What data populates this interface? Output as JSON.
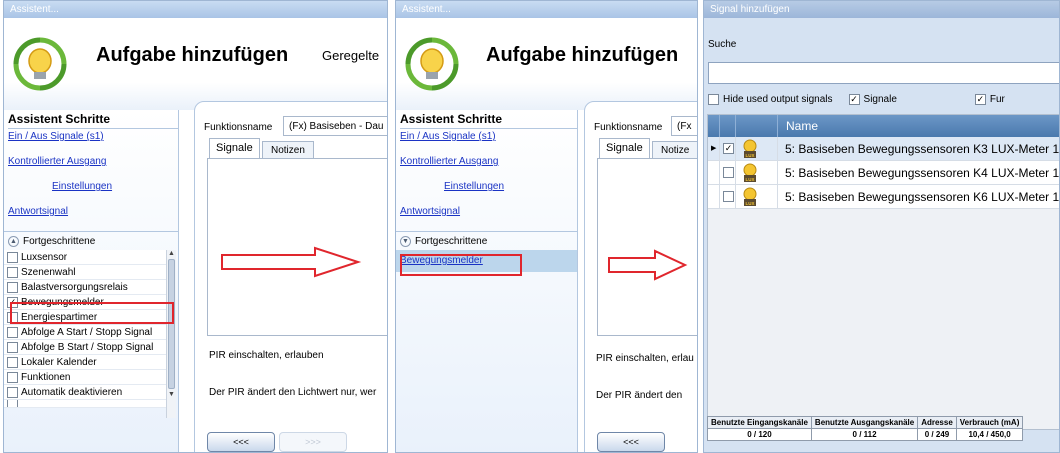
{
  "panel1": {
    "window_title": "Assistent...",
    "header_title": "Aufgabe hinzufügen",
    "header_subtitle": "Geregelte",
    "steps_title": "Assistent Schritte",
    "steps": [
      "Ein / Aus Signale (s1)",
      "Kontrollierter Ausgang",
      "Einstellungen",
      "Antwortsignal"
    ],
    "advanced_label": "Fortgeschrittene",
    "advanced_items": [
      {
        "label": "Luxsensor",
        "checked": false
      },
      {
        "label": "Szenenwahl",
        "checked": false
      },
      {
        "label": "Balastversorgungsrelais",
        "checked": false
      },
      {
        "label": "Bewegungsmelder",
        "checked": true
      },
      {
        "label": "Energiespartimer",
        "checked": false
      },
      {
        "label": "Abfolge A Start / Stopp Signal",
        "checked": false
      },
      {
        "label": "Abfolge B Start / Stopp Signal",
        "checked": false
      },
      {
        "label": "Lokaler Kalender",
        "checked": false
      },
      {
        "label": "Funktionen",
        "checked": false
      },
      {
        "label": "Automatik deaktivieren",
        "checked": false
      }
    ],
    "function_name_label": "Funktionsname",
    "function_name_value": "(Fx) Basiseben - Dau",
    "tab_signals": "Signale",
    "tab_notes": "Notizen",
    "desc1": "PIR einschalten, erlauben",
    "desc2": "Der PIR ändert den Lichtwert nur, wer",
    "btn_back": "<<<",
    "btn_next": ">>>"
  },
  "panel2": {
    "window_title": "Assistent...",
    "header_title": "Aufgabe hinzufügen",
    "steps_title": "Assistent Schritte",
    "steps": [
      "Ein / Aus Signale (s1)",
      "Kontrollierter Ausgang",
      "Einstellungen",
      "Antwortsignal"
    ],
    "advanced_label": "Fortgeschrittene",
    "selected_step": "Bewegungsmelder",
    "function_name_label": "Funktionsname",
    "function_name_value": "(Fx",
    "tab_signals": "Signale",
    "tab_notes": "Notize",
    "desc1": "PIR einschalten, erlau",
    "desc2": "Der PIR ändert den",
    "btn_back": "<<<"
  },
  "panel3": {
    "window_title": "Signal hinzufügen",
    "search_label": "Suche",
    "search_value": "",
    "filter_hide": "Hide used output signals",
    "filter_signals": "Signale",
    "filter_fun": "Fur",
    "column_name": "Name",
    "rows": [
      {
        "text": "5: Basiseben Bewegungssensoren K3 LUX-Meter 1",
        "checked": true,
        "selected": true
      },
      {
        "text": "5: Basiseben Bewegungssensoren K4 LUX-Meter 1",
        "checked": false,
        "selected": false
      },
      {
        "text": "5: Basiseben Bewegungssensoren K6 LUX-Meter 1",
        "checked": false,
        "selected": false
      }
    ],
    "icon_label": "LUX",
    "stats_headers": [
      "Benutzte Eingangskanäle",
      "Benutzte Ausgangskanäle",
      "Adresse",
      "Verbrauch (mA)"
    ],
    "stats_values": [
      "0 / 120",
      "0 / 112",
      "0 / 249",
      "10,4 / 450,0"
    ]
  },
  "colors": {
    "accent": "#e0262d",
    "link": "#1a33c4",
    "grid_header": "#4a79ad"
  }
}
